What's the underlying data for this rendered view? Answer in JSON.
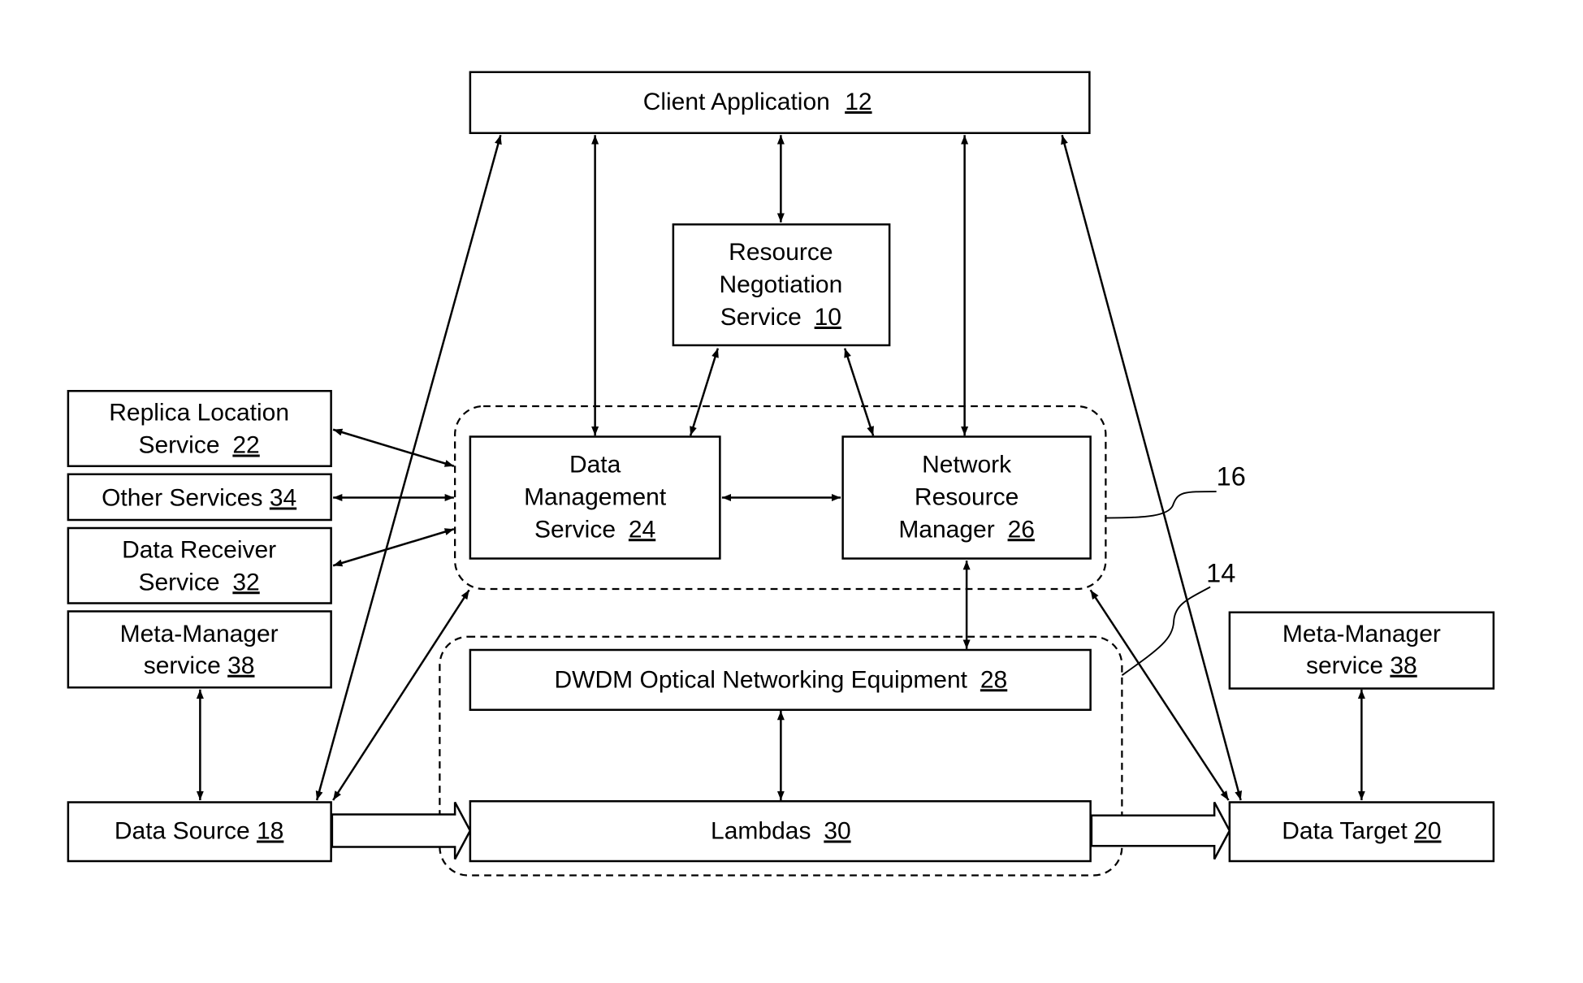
{
  "diagram": {
    "colors": {
      "stroke": "#000000",
      "background": "#ffffff"
    },
    "nodes": {
      "client_application": {
        "label": "Client Application",
        "ref": "12"
      },
      "resource_negotiation": {
        "lines": [
          "Resource",
          "Negotiation",
          "Service"
        ],
        "ref": "10"
      },
      "replica_location": {
        "lines": [
          "Replica Location",
          "Service"
        ],
        "ref": "22"
      },
      "other_services": {
        "label": "Other Services",
        "ref": "34"
      },
      "data_receiver": {
        "lines": [
          "Data Receiver",
          "Service"
        ],
        "ref": "32"
      },
      "meta_manager_left": {
        "lines": [
          "Meta-Manager",
          "service"
        ],
        "ref": "38"
      },
      "data_management": {
        "lines": [
          "Data",
          "Management",
          "Service"
        ],
        "ref": "24"
      },
      "network_resource_manager": {
        "lines": [
          "Network",
          "Resource",
          "Manager"
        ],
        "ref": "26"
      },
      "dwdm": {
        "label": "DWDM Optical Networking Equipment",
        "ref": "28"
      },
      "lambdas": {
        "label": "Lambdas",
        "ref": "30"
      },
      "data_source": {
        "label": "Data Source",
        "ref": "18"
      },
      "data_target": {
        "label": "Data Target",
        "ref": "20"
      },
      "meta_manager_right": {
        "lines": [
          "Meta-Manager",
          "service"
        ],
        "ref": "38"
      }
    },
    "groups": {
      "middleware_group": {
        "callout": "16"
      },
      "optical_group": {
        "callout": "14"
      }
    },
    "edges": [
      {
        "from": "Client Application",
        "to": "Resource Negotiation Service",
        "type": "bidirectional"
      },
      {
        "from": "Client Application",
        "to": "Data Management Service",
        "type": "bidirectional"
      },
      {
        "from": "Client Application",
        "to": "Network Resource Manager",
        "type": "bidirectional"
      },
      {
        "from": "Client Application",
        "to": "Data Source",
        "type": "bidirectional"
      },
      {
        "from": "Client Application",
        "to": "Data Target",
        "type": "bidirectional"
      },
      {
        "from": "Resource Negotiation Service",
        "to": "Data Management Service",
        "type": "bidirectional"
      },
      {
        "from": "Resource Negotiation Service",
        "to": "Network Resource Manager",
        "type": "bidirectional"
      },
      {
        "from": "Data Management Service",
        "to": "Network Resource Manager",
        "type": "bidirectional"
      },
      {
        "from": "Replica Location Service",
        "to": "Middleware Group",
        "type": "bidirectional"
      },
      {
        "from": "Other Services",
        "to": "Middleware Group",
        "type": "bidirectional"
      },
      {
        "from": "Data Receiver Service",
        "to": "Middleware Group",
        "type": "bidirectional"
      },
      {
        "from": "Meta-Manager service (left)",
        "to": "Data Source",
        "type": "bidirectional"
      },
      {
        "from": "Data Source",
        "to": "Middleware Group",
        "type": "bidirectional"
      },
      {
        "from": "Network Resource Manager",
        "to": "DWDM Optical Networking Equipment",
        "type": "bidirectional"
      },
      {
        "from": "DWDM Optical Networking Equipment",
        "to": "Lambdas",
        "type": "bidirectional"
      },
      {
        "from": "Middleware Group",
        "to": "Data Target",
        "type": "bidirectional"
      },
      {
        "from": "Meta-Manager service (right)",
        "to": "Data Target",
        "type": "bidirectional"
      },
      {
        "from": "Data Source",
        "to": "Lambdas",
        "type": "data-flow"
      },
      {
        "from": "Lambdas",
        "to": "Data Target",
        "type": "data-flow"
      }
    ]
  }
}
